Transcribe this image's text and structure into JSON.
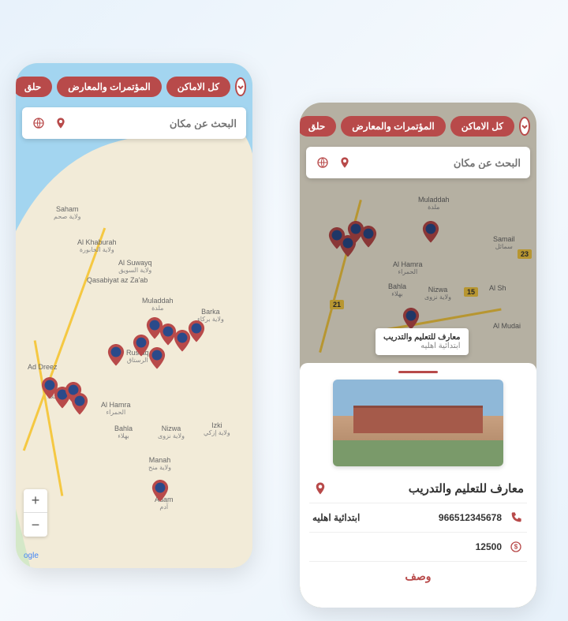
{
  "colors": {
    "accent": "#b84a4a"
  },
  "chips": {
    "all_places": "كل الاماكن",
    "conferences": "المؤتمرات والمعارض",
    "partial": "حلق"
  },
  "search": {
    "placeholder": "البحث عن مكان"
  },
  "map_attrib": "ogle",
  "zoom": {
    "plus": "+",
    "minus": "−"
  },
  "cities": [
    {
      "en": "Saham",
      "ar": "ولاية صحم"
    },
    {
      "en": "Al Khaburah",
      "ar": "ولاية الخابورة"
    },
    {
      "en": "Al Suwayq",
      "ar": "ولاية السويق"
    },
    {
      "en": "Qasabiyat az Za'ab",
      "ar": ""
    },
    {
      "en": "Muladdah",
      "ar": "ملدة"
    },
    {
      "en": "Barka",
      "ar": "ولاية بركاء"
    },
    {
      "en": "Rustaq",
      "ar": "الرستاق"
    },
    {
      "en": "Ad Dreez",
      "ar": ""
    },
    {
      "en": "Ar",
      "ar": "عملاء"
    },
    {
      "en": "Al Hamra",
      "ar": "الحمراء"
    },
    {
      "en": "Bahla",
      "ar": "بهلاء"
    },
    {
      "en": "Nizwa",
      "ar": "ولاية نزوى"
    },
    {
      "en": "Izki",
      "ar": "ولاية إزكي"
    },
    {
      "en": "Manah",
      "ar": "ولاية منح"
    },
    {
      "en": "Adam",
      "ar": "آدم"
    }
  ],
  "right_cities": [
    {
      "en": "Muladdah",
      "ar": "ملدة"
    },
    {
      "en": "Al Hamra",
      "ar": "الحمراء"
    },
    {
      "en": "Bahla",
      "ar": "بهلاء"
    },
    {
      "en": "Nizwa",
      "ar": "ولاية نزوى"
    },
    {
      "en": "Al Sh",
      "ar": ""
    },
    {
      "en": "Samail",
      "ar": "سمائل"
    },
    {
      "en": "Al Mudai",
      "ar": ""
    }
  ],
  "road_badges": {
    "r21": "21",
    "r15": "15",
    "r23": "23"
  },
  "tooltip": {
    "title": "معارف للتعليم والتدريب",
    "sub": "ابتدائية اهليه"
  },
  "detail": {
    "title": "معارف للتعليم والتدريب",
    "phone": "966512345678",
    "category": "ابتدائية اهليه",
    "price": "12500",
    "footer": "وصف"
  }
}
